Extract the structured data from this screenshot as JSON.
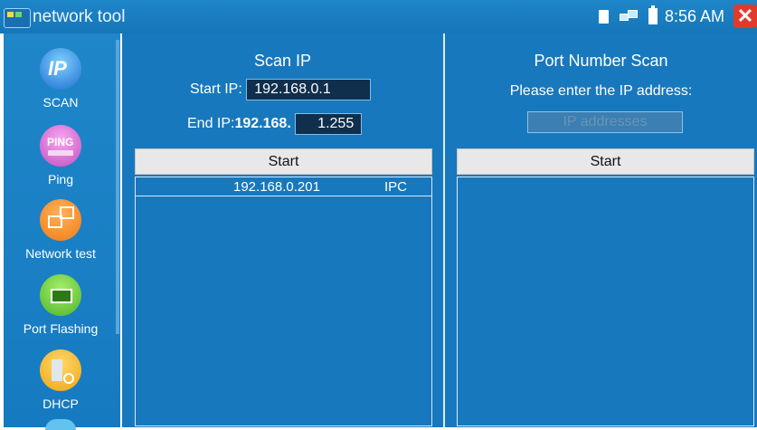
{
  "app": {
    "title": "network tool"
  },
  "statusbar": {
    "time": "8:56 AM",
    "icons": [
      "sim-card-icon",
      "network-icon",
      "battery-icon",
      "close-icon"
    ],
    "close_glyph": "✕"
  },
  "sidebar": {
    "items": [
      {
        "label": "SCAN",
        "icon": "ip-scan-icon",
        "icon_text": "IP"
      },
      {
        "label": "Ping",
        "icon": "ping-icon",
        "icon_text": "PING"
      },
      {
        "label": "Network test",
        "icon": "network-test-icon"
      },
      {
        "label": "Port Flashing",
        "icon": "port-flashing-icon"
      },
      {
        "label": "DHCP",
        "icon": "dhcp-icon"
      }
    ]
  },
  "scan_ip": {
    "title": "Scan IP",
    "start_label": "Start IP:",
    "start_value": "192.168.0.1",
    "end_label": "End IP:",
    "end_prefix": "192.168.",
    "end_value": "1.255",
    "start_button": "Start",
    "results": [
      {
        "ip": "192.168.0.201",
        "type": "IPC"
      }
    ]
  },
  "port_scan": {
    "title": "Port Number Scan",
    "prompt": "Please enter the IP address:",
    "ip_placeholder": "IP addresses",
    "start_button": "Start"
  },
  "colors": {
    "panel": "#1878bd",
    "titlebar": "#1f86c9",
    "button": "#e8e8e8",
    "close": "#e23a2a"
  }
}
